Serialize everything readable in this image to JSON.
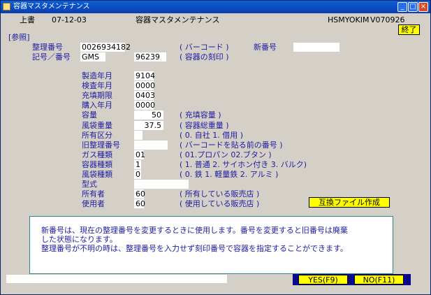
{
  "window": {
    "title": "容器マスタメンテナンス",
    "minimize": "_",
    "maximize": "□",
    "close": "×"
  },
  "header": {
    "mode": "上書",
    "date": "07-12-03",
    "title": "容器マスタメンテナンス",
    "program_id": "HSMYOKIM",
    "version": "V070926",
    "exit_label": "終了"
  },
  "section_label": "[参照]",
  "top_fields": {
    "seiri_label": "整理番号",
    "seiri_value": "0026934182",
    "seiri_note": "( バーコード )",
    "new_label": "新番号",
    "new_value": "",
    "kigou_label": "記号／番号",
    "kigou_value": "GMS",
    "bangou_value": "96239",
    "kigou_note": "( 容器の刻印 )"
  },
  "fields": [
    {
      "label": "製造年月",
      "value": "9104",
      "note": ""
    },
    {
      "label": "検査年月",
      "value": "0000",
      "note": ""
    },
    {
      "label": "充填期限",
      "value": "0403",
      "note": ""
    },
    {
      "label": "購入年月",
      "value": "0000",
      "note": ""
    },
    {
      "label": "容量",
      "value": "50",
      "note": "( 充填容量 )"
    },
    {
      "label": "風袋重量",
      "value": "37.5",
      "note": "( 容器総重量 )"
    },
    {
      "label": "所有区分",
      "value": "",
      "note": "( 0. 自社  1. 借用 )"
    },
    {
      "label": "旧整理番号",
      "value": "",
      "note": "( バーコードを貼る前の番号 )"
    },
    {
      "label": "ガス種類",
      "value": "01",
      "note": "( 01.プロパン  02.ブタン )"
    },
    {
      "label": "容器種類",
      "value": "1",
      "note": "( 1. 普通  2. サイホン付き  3. バルク)"
    },
    {
      "label": "風袋種類",
      "value": "0",
      "note": "( 0. 鉄  1. 軽量鉄  2. アルミ )"
    },
    {
      "label": "型式",
      "value": "",
      "note": ""
    },
    {
      "label": "所有者",
      "value": "60",
      "note": "( 所有している販売店 )"
    },
    {
      "label": "使用者",
      "value": "60",
      "note": "( 使用している販売店 )"
    }
  ],
  "compat_button": "互換ファイル作成",
  "notes": [
    "新番号は、現在の整理番号を変更するときに使用します。番号を変更すると旧番号は廃棄",
    "した状態になります。",
    "整理番号が不明の時は、整理番号を入力せず刻印番号で容器を指定することができます。"
  ],
  "buttons": {
    "yes": "YES(F9)",
    "no": "NO(F11)"
  },
  "colors": {
    "label": "#1d1da0",
    "button": "#ffff00",
    "title_bar": "#0a5fd6",
    "form_bg": "#d4d0c8"
  }
}
